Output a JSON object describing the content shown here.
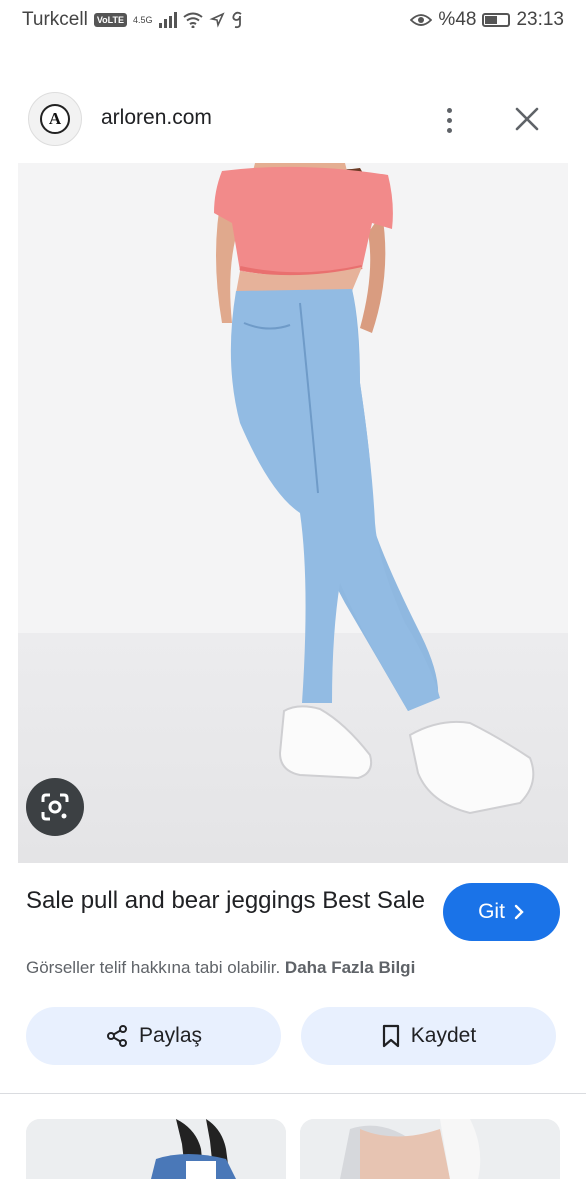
{
  "status_bar": {
    "carrier": "Turkcell",
    "volte": "VoLTE",
    "network": "4.5G",
    "battery": "%48",
    "battery_level": 0.48,
    "time": "23:13"
  },
  "header": {
    "logo_letter": "A",
    "site": "arloren.com"
  },
  "result": {
    "title": "Sale pull and bear jeggings Best Sale",
    "go_label": "Git",
    "copyright_text": "Görseller telif hakkına tabi olabilir.",
    "more_info_link": "Daha Fazla Bilgi"
  },
  "actions": {
    "share_label": "Paylaş",
    "save_label": "Kaydet"
  },
  "colors": {
    "accent": "#1a73e8",
    "action_bg": "#e8f0fe",
    "shirt": "#f28a8a",
    "jeans": "#8fb8e0"
  }
}
